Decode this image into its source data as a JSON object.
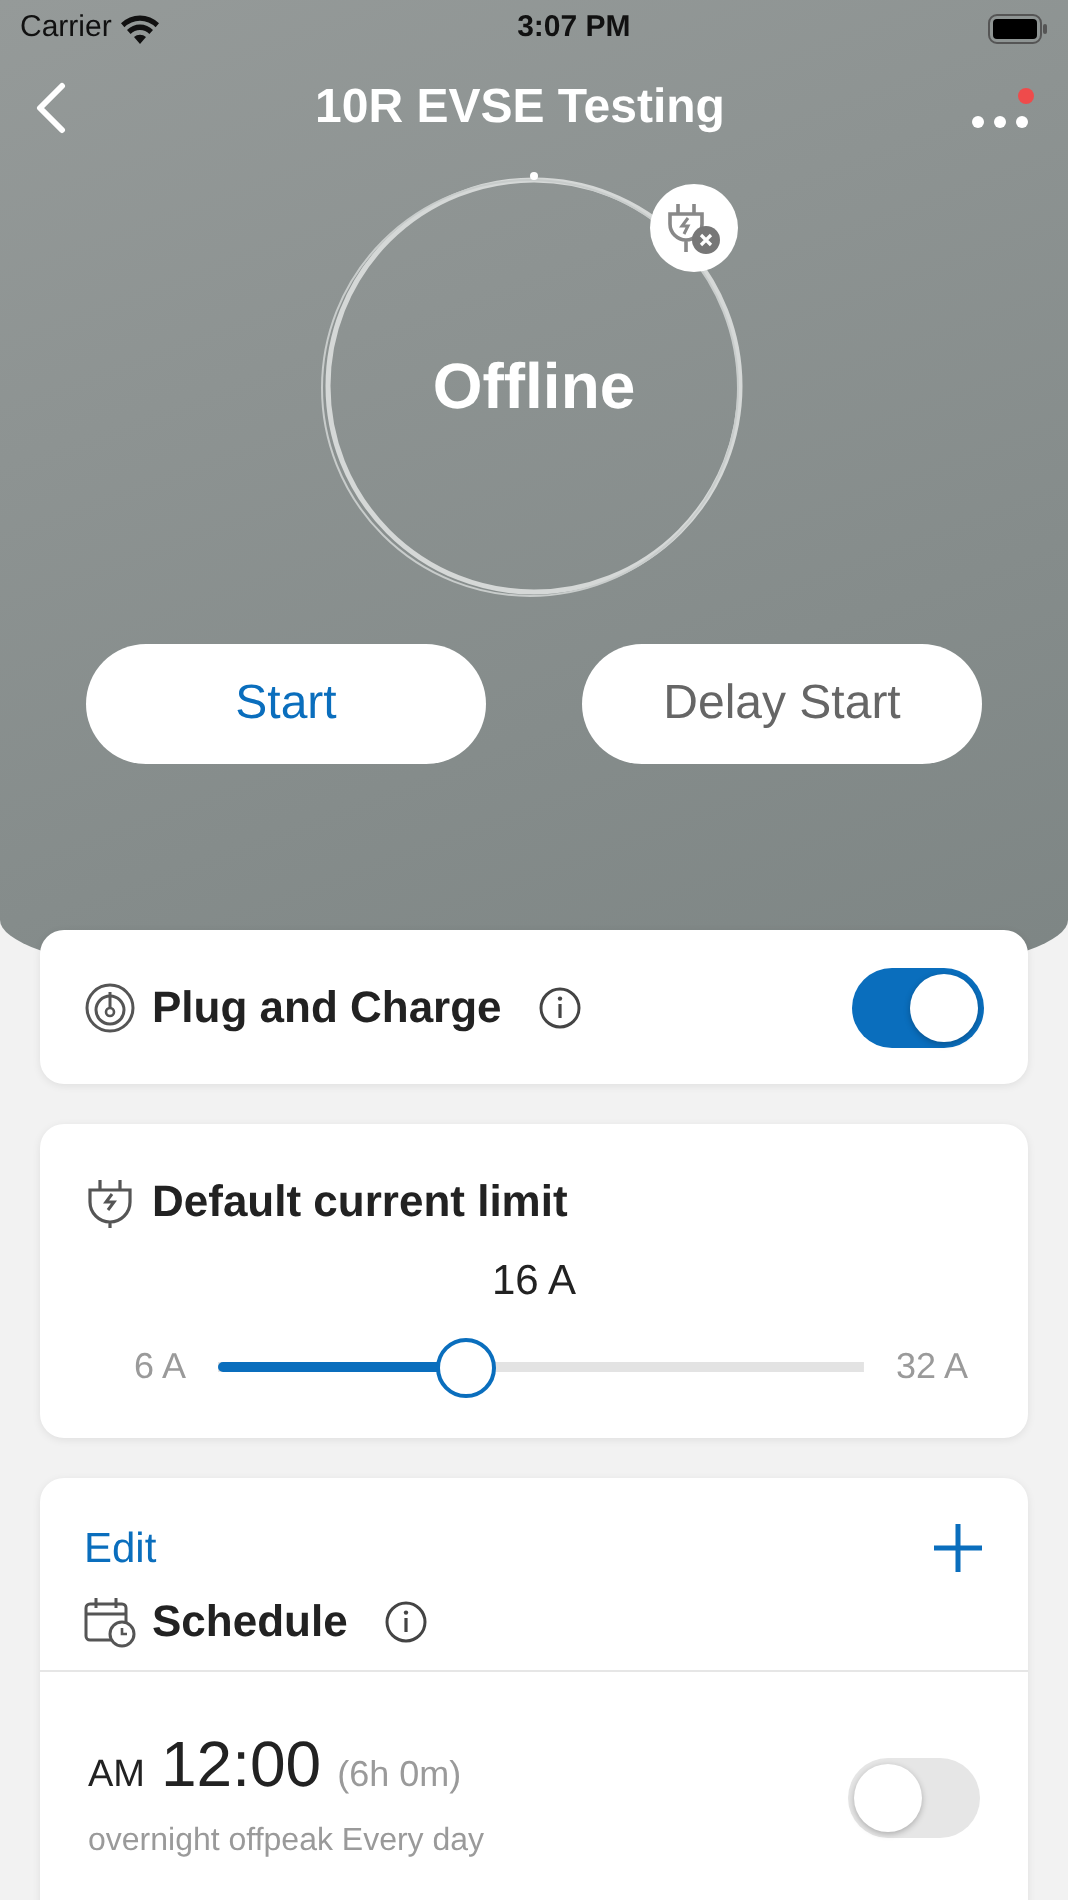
{
  "status_bar": {
    "carrier": "Carrier",
    "time": "3:07 PM"
  },
  "nav": {
    "title": "10R EVSE Testing",
    "menu_badge": true
  },
  "charger": {
    "status": "Offline",
    "plug_error": true
  },
  "actions": [
    {
      "label": "Start",
      "disabled": false
    },
    {
      "label": "Delay Start",
      "disabled": true
    }
  ],
  "plug_and_charge": {
    "title": "Plug and Charge",
    "on": true
  },
  "current_limit": {
    "title": "Default current limit",
    "reading": "16 A",
    "min": "6 A",
    "max": "32 A",
    "level": 0.385
  },
  "schedule": {
    "edit": "Edit",
    "title": "Schedule",
    "items": [
      {
        "period": "AM",
        "time": "12:00",
        "duration": "(6h 0m)",
        "description": "overnight offpeak Every day",
        "on": false
      }
    ]
  }
}
